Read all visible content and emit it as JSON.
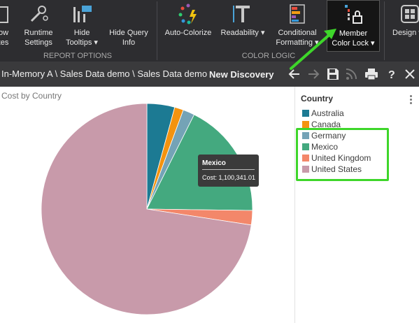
{
  "ribbon": {
    "buttons": [
      {
        "label": "ow\ntes"
      },
      {
        "label": "Runtime\nSettings"
      },
      {
        "label": "Hide\nTooltips ▾"
      },
      {
        "label": "Hide Query\nInfo"
      },
      {
        "label": "Auto-Colorize"
      },
      {
        "label": "Readability ▾"
      },
      {
        "label": "Conditional\nFormatting ▾"
      },
      {
        "label": "Member\nColor Lock ▾"
      },
      {
        "label": "Design ▾"
      }
    ],
    "groups": {
      "report_options": "REPORT OPTIONS",
      "color_logic": "COLOR LOGIC"
    }
  },
  "address_bar": {
    "path": "In-Memory A \\ Sales Data demo \\ Sales Data demo",
    "discovery": "New Discovery"
  },
  "chart_data": {
    "type": "pie",
    "title": "Cost by Country",
    "legend_title": "Country",
    "legend_placement": "right",
    "series": [
      {
        "name": "Australia",
        "value": 262000,
        "color": "#1c7a93"
      },
      {
        "name": "Canada",
        "value": 84000,
        "color": "#f3930f"
      },
      {
        "name": "Germany",
        "value": 110000,
        "color": "#74a3b6"
      },
      {
        "name": "Mexico",
        "value": 1100341.01,
        "color": "#44a97f"
      },
      {
        "name": "United Kingdom",
        "value": 136000,
        "color": "#f3876a"
      },
      {
        "name": "United States",
        "value": 4480000,
        "color": "#c89aaa"
      }
    ]
  },
  "tooltip": {
    "header": "Mexico",
    "value": "Cost: 1,100,341.01"
  }
}
